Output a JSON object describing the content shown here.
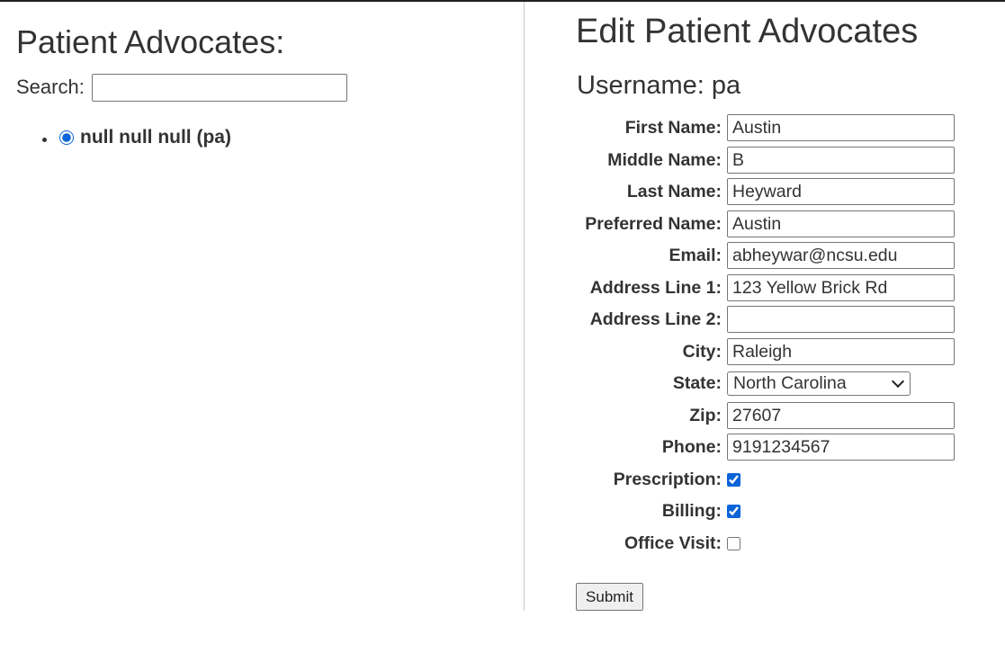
{
  "left": {
    "title": "Patient Advocates:",
    "search_label": "Search:",
    "search_value": "",
    "advocates": [
      {
        "label": "null null null (pa)",
        "selected": true
      }
    ]
  },
  "right": {
    "title": "Edit Patient Advocates",
    "username": "Username: pa",
    "fields": {
      "first_name": {
        "label": "First Name:",
        "value": "Austin"
      },
      "middle_name": {
        "label": "Middle Name:",
        "value": "B"
      },
      "last_name": {
        "label": "Last Name:",
        "value": "Heyward"
      },
      "preferred_name": {
        "label": "Preferred Name:",
        "value": "Austin"
      },
      "email": {
        "label": "Email:",
        "value": "abheywar@ncsu.edu"
      },
      "address1": {
        "label": "Address Line 1:",
        "value": "123 Yellow Brick Rd"
      },
      "address2": {
        "label": "Address Line 2:",
        "value": ""
      },
      "city": {
        "label": "City:",
        "value": "Raleigh"
      },
      "state": {
        "label": "State:",
        "value": "North Carolina"
      },
      "zip": {
        "label": "Zip:",
        "value": "27607"
      },
      "phone": {
        "label": "Phone:",
        "value": "9191234567"
      }
    },
    "checkboxes": {
      "prescription": {
        "label": "Prescription:",
        "checked": true
      },
      "billing": {
        "label": "Billing:",
        "checked": true
      },
      "office_visit": {
        "label": "Office Visit:",
        "checked": false
      }
    },
    "submit_label": "Submit"
  },
  "colors": {
    "accent": "#0b64d8",
    "text": "#333333",
    "divider": "#c8c8c8"
  }
}
